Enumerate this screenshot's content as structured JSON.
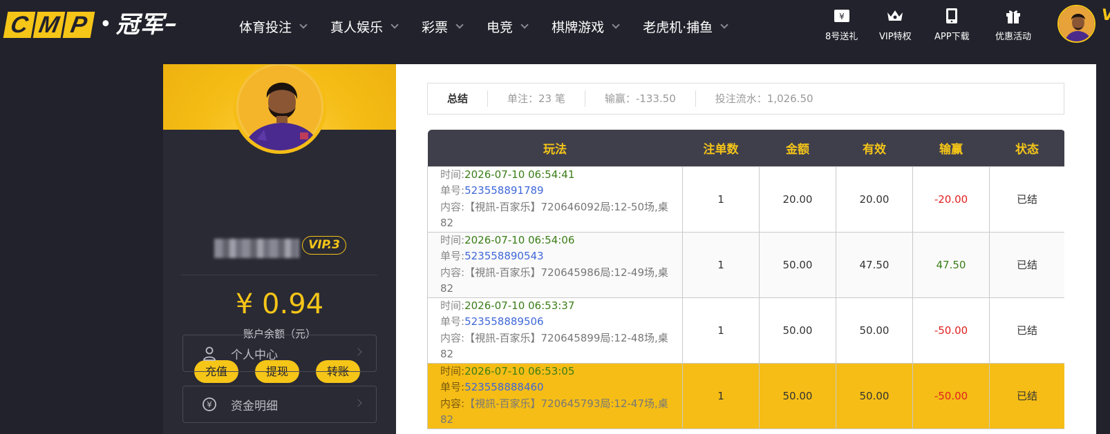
{
  "header": {
    "logo_letters": [
      "C",
      "M",
      "P"
    ],
    "logo_cn": "冠军",
    "nav": [
      "体育投注",
      "真人娱乐",
      "彩票",
      "电竞",
      "棋牌游戏",
      "老虎机·捕鱼"
    ],
    "quick_links": [
      {
        "label": "8号送礼",
        "icon": "gift-ticket-icon"
      },
      {
        "label": "VIP特权",
        "icon": "crown-icon"
      },
      {
        "label": "APP下载",
        "icon": "phone-icon"
      },
      {
        "label": "优惠活动",
        "icon": "gift-box-icon"
      }
    ],
    "vip_fragment": "V"
  },
  "sidebar": {
    "vip_level": "VIP.3",
    "balance": "¥ 0.94",
    "balance_label": "账户余额（元）",
    "buttons": [
      "充值",
      "提现",
      "转账"
    ],
    "menu": [
      {
        "label": "个人中心",
        "icon": "user-icon"
      },
      {
        "label": "资金明细",
        "icon": "currency-icon"
      }
    ]
  },
  "summary": {
    "title": "总结",
    "orders": "单注：23 笔",
    "winloss": "输赢：-133.50",
    "turnover": "投注流水：1,026.50"
  },
  "table": {
    "headers": [
      "玩法",
      "注单数",
      "金额",
      "有效",
      "输赢",
      "状态"
    ],
    "labels": {
      "time": "时间:",
      "id": "单号:",
      "content": "内容:"
    },
    "rows": [
      {
        "time": "2026-07-10 06:54:41",
        "id": "523558891789",
        "content": "【視訊-百家乐】720646092局:12-50场,桌82",
        "count": "1",
        "amount": "20.00",
        "valid": "20.00",
        "winloss": "-20.00",
        "status": "已结"
      },
      {
        "time": "2026-07-10 06:54:06",
        "id": "523558890543",
        "content": "【視訊-百家乐】720645986局:12-49场,桌82",
        "count": "1",
        "amount": "50.00",
        "valid": "47.50",
        "winloss": "47.50",
        "status": "已结"
      },
      {
        "time": "2026-07-10 06:53:37",
        "id": "523558889506",
        "content": "【視訊-百家乐】720645899局:12-48场,桌82",
        "count": "1",
        "amount": "50.00",
        "valid": "50.00",
        "winloss": "-50.00",
        "status": "已结"
      },
      {
        "time": "2026-07-10 06:53:05",
        "id": "523558888460",
        "content": "【視訊-百家乐】720645793局:12-47场,桌82",
        "count": "1",
        "amount": "50.00",
        "valid": "50.00",
        "winloss": "-50.00",
        "status": "已结"
      }
    ]
  },
  "colors": {
    "accent": "#f5c518",
    "dark": "#22222c",
    "negative": "#e02020",
    "positive": "#3a7d17",
    "link": "#3f67d8"
  }
}
